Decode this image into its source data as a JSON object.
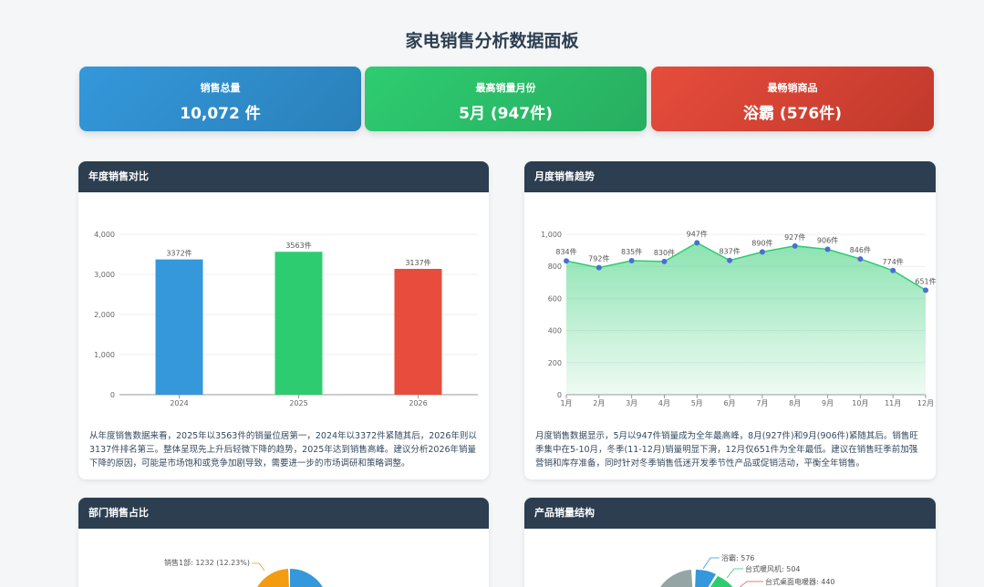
{
  "header": {
    "title": "家电销售分析数据面板"
  },
  "kpis": [
    {
      "label": "销售总量",
      "value": "10,072 件"
    },
    {
      "label": "最高销量月份",
      "value": "5月 (947件)"
    },
    {
      "label": "最畅销商品",
      "value": "浴霸 (576件)"
    }
  ],
  "cards": {
    "yearly": {
      "title": "年度销售对比",
      "desc": "从年度销售数据来看，2025年以3563件的销量位居第一，2024年以3372件紧随其后，2026年则以3137件排名第三。整体呈现先上升后轻微下降的趋势，2025年达到销售高峰。建议分析2026年销量下降的原因，可能是市场饱和或竞争加剧导致，需要进一步的市场调研和策略调整。"
    },
    "monthly": {
      "title": "月度销售趋势",
      "desc": "月度销售数据显示，5月以947件销量成为全年最高峰，8月(927件)和9月(906件)紧随其后。销售旺季集中在5-10月，冬季(11-12月)销量明显下滑，12月仅651件为全年最低。建议在销售旺季前加强营销和库存准备，同时针对冬季销售低迷开发季节性产品或促销活动，平衡全年销售。"
    },
    "dept": {
      "title": "部门销售占比",
      "label_text": "销售1部: 1232 (12.23%)"
    },
    "product": {
      "title": "产品销量结构",
      "labels": [
        "浴霸: 576",
        "台式暖风机: 504",
        "台式桌面电暖器: 440"
      ]
    }
  },
  "chart_data": [
    {
      "type": "bar",
      "title": "年度销售对比",
      "categories": [
        "2024",
        "2025",
        "2026"
      ],
      "values": [
        3372,
        3563,
        3137
      ],
      "data_labels": [
        "3372件",
        "3563件",
        "3137件"
      ],
      "colors": [
        "#3498db",
        "#2ecc71",
        "#e74c3c"
      ],
      "yticks": [
        "0",
        "1,000",
        "2,000",
        "3,000",
        "4,000"
      ],
      "ylim": [
        0,
        4000
      ],
      "grid": true
    },
    {
      "type": "area",
      "title": "月度销售趋势",
      "categories": [
        "1月",
        "2月",
        "3月",
        "4月",
        "5月",
        "6月",
        "7月",
        "8月",
        "9月",
        "10月",
        "11月",
        "12月"
      ],
      "values": [
        834,
        792,
        835,
        830,
        947,
        837,
        890,
        927,
        906,
        846,
        774,
        651
      ],
      "data_labels": [
        "834件",
        "792件",
        "835件",
        "830件",
        "947件",
        "837件",
        "890件",
        "927件",
        "906件",
        "846件",
        "774件",
        "651件"
      ],
      "yticks": [
        "0",
        "200",
        "400",
        "600",
        "800",
        "1,000"
      ],
      "ylim": [
        0,
        1000
      ],
      "grid": true,
      "colors": {
        "line": "#2ecc71",
        "point": "#4a6fd1",
        "fill": "#2ecc71"
      }
    }
  ]
}
